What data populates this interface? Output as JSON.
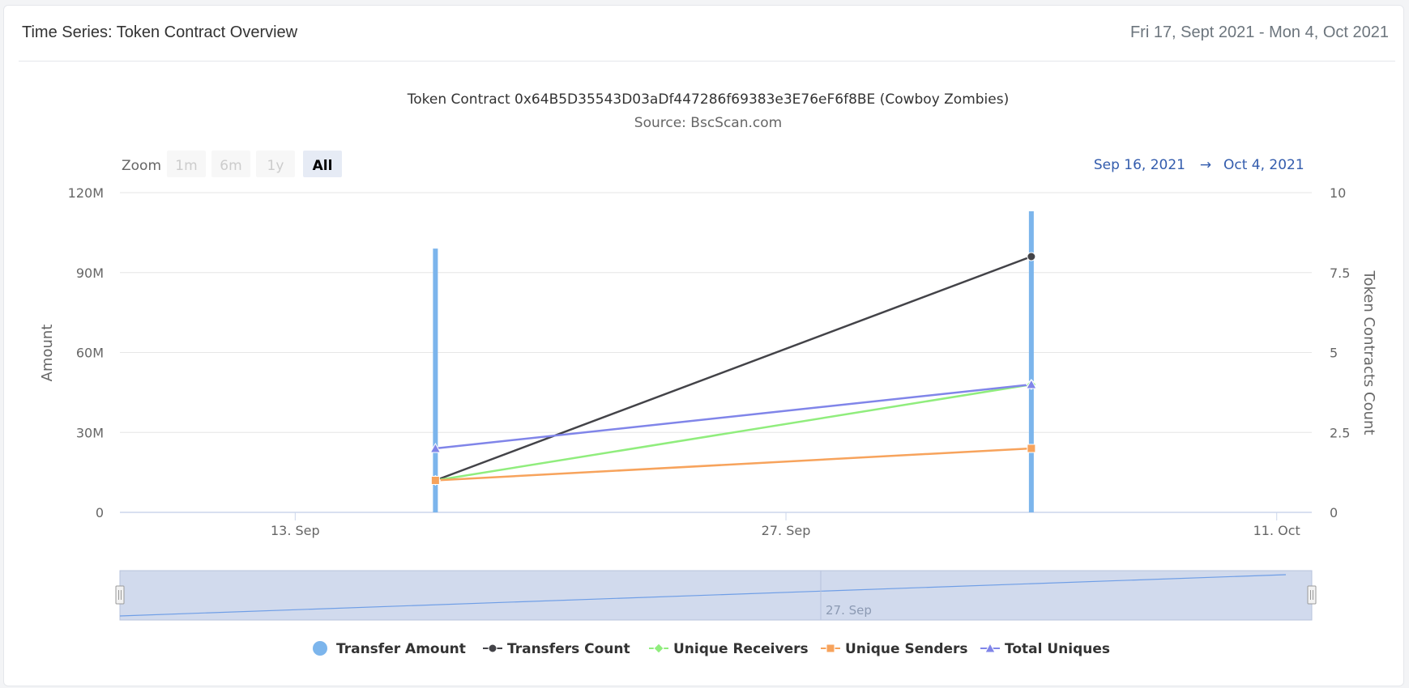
{
  "header": {
    "title": "Time Series: Token Contract Overview",
    "date_range": "Fri 17, Sept 2021 - Mon 4, Oct 2021"
  },
  "zoom": {
    "label": "Zoom",
    "buttons": [
      "1m",
      "6m",
      "1y",
      "All"
    ],
    "active": "All"
  },
  "range_display": {
    "from": "Sep 16, 2021",
    "arrow": "→",
    "to": "Oct 4, 2021"
  },
  "colors": {
    "transfer_amount": "#7cb5ec",
    "transfers_count": "#434348",
    "unique_receivers": "#90ed7d",
    "unique_senders": "#f7a35c",
    "total_uniques": "#8085e9",
    "navigator_fill": "#ccd6eb",
    "navigator_line": "#6f9ee6",
    "range_text": "#335cad"
  },
  "chart_data": {
    "type": "line",
    "title": "Token Contract 0x64B5D35543D03aDf447286f69383e3E76eF6f8BE (Cowboy Zombies)",
    "subtitle": "Source: BscScan.com",
    "xlabel": "",
    "x_ticks": [
      "13. Sep",
      "27. Sep",
      "11. Oct"
    ],
    "x_tick_dates": [
      "2021-09-13",
      "2021-09-27",
      "2021-10-11"
    ],
    "xlim": [
      "2021-09-08",
      "2021-10-12"
    ],
    "y_left": {
      "label": "Amount",
      "ticks": [
        "0",
        "30M",
        "60M",
        "90M",
        "120M"
      ],
      "ylim": [
        0,
        120000000
      ]
    },
    "y_right": {
      "label": "Token Contracts Count",
      "ticks": [
        "0",
        "2.5",
        "5",
        "7.5",
        "10"
      ],
      "ylim": [
        0,
        10
      ]
    },
    "x": [
      "2021-09-17",
      "2021-10-04"
    ],
    "series": [
      {
        "name": "Transfer Amount",
        "type": "column",
        "axis": "left",
        "values": [
          99000000,
          113000000
        ]
      },
      {
        "name": "Transfers Count",
        "type": "line",
        "axis": "right",
        "marker": "circle",
        "values": [
          1,
          8
        ]
      },
      {
        "name": "Unique Receivers",
        "type": "line",
        "axis": "right",
        "marker": "diamond",
        "values": [
          1,
          4
        ]
      },
      {
        "name": "Unique Senders",
        "type": "line",
        "axis": "right",
        "marker": "square",
        "values": [
          1,
          2
        ]
      },
      {
        "name": "Total Uniques",
        "type": "line",
        "axis": "right",
        "marker": "triangle",
        "values": [
          2,
          4
        ]
      }
    ],
    "navigator": {
      "tick": "27. Sep"
    },
    "legend_placement": "bottom-center",
    "grid": true
  }
}
